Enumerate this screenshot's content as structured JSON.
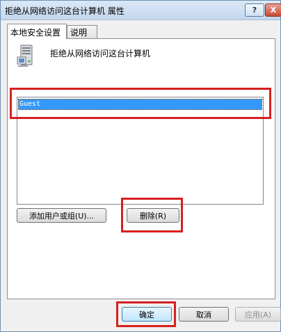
{
  "window": {
    "title": "拒绝从网络访问这台计算机 属性",
    "help_glyph": "?",
    "close_glyph": "X"
  },
  "tabs": [
    {
      "label": "本地安全设置",
      "active": true
    },
    {
      "label": "说明",
      "active": false
    }
  ],
  "policy": {
    "icon": "server-computer-icon",
    "title": "拒绝从网络访问这台计算机"
  },
  "accounts": {
    "items": [
      "Guest"
    ],
    "selected": "Guest"
  },
  "buttons": {
    "add": "添加用户或组(U)...",
    "remove": "删除(R)",
    "ok": "确定",
    "cancel": "取消",
    "apply": "应用(A)"
  },
  "colors": {
    "selection": "#3399ff",
    "highlight": "#d62020"
  }
}
